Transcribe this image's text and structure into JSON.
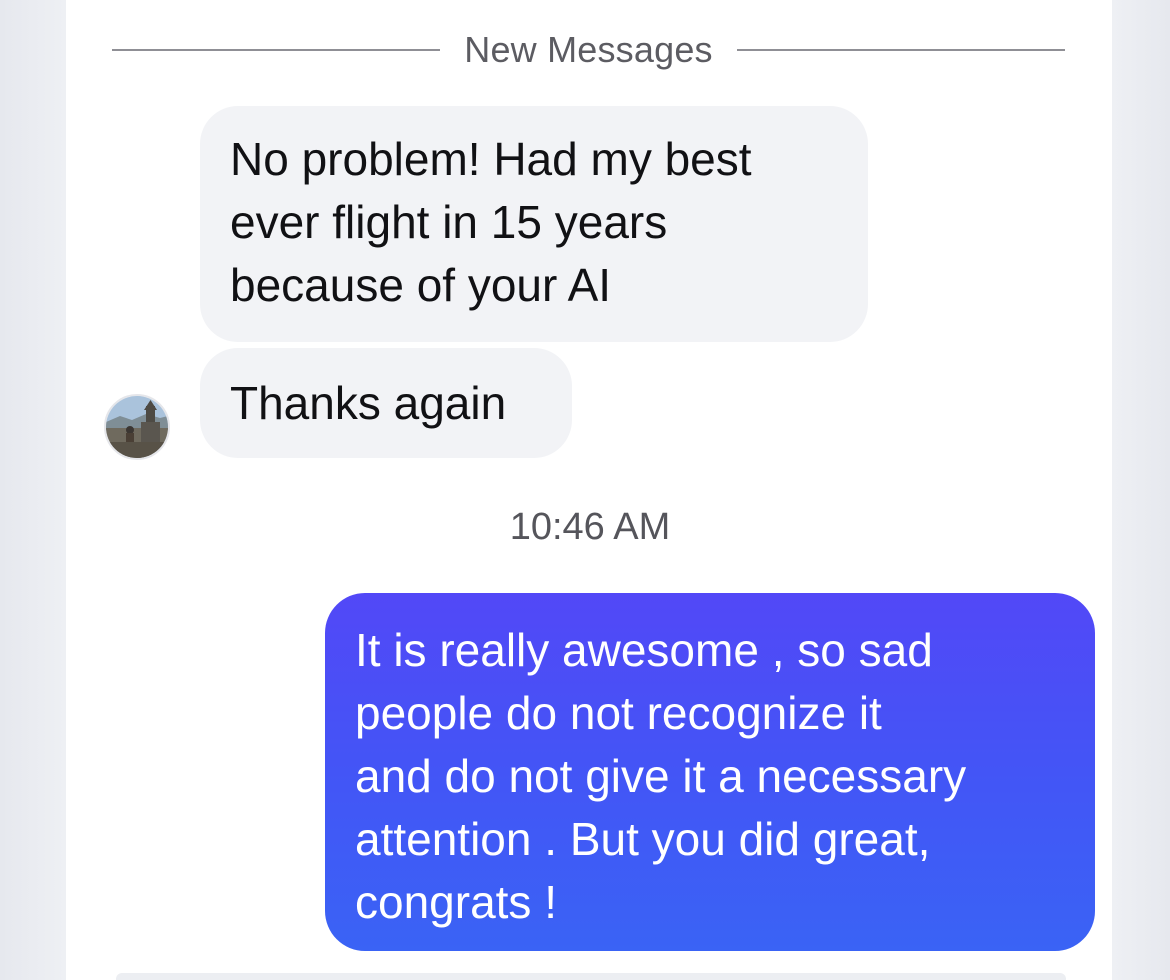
{
  "thread": {
    "new_messages_label": "New Messages",
    "timestamp": "10:46 AM",
    "incoming": [
      {
        "text": "No problem! Had my best\never flight in 15 years\nbecause of your AI"
      },
      {
        "text": "Thanks again"
      }
    ],
    "outgoing": [
      {
        "text": "It is really awesome , so sad\npeople do not recognize it\nand do not give it a necessary\nattention . But you did great,\ncongrats !"
      }
    ]
  },
  "colors": {
    "incoming_bubble": "#f2f3f6",
    "outgoing_bubble_top": "#5248f7",
    "outgoing_bubble_bottom": "#3a63f5",
    "outgoing_text": "#ffffff",
    "divider_line": "#8f8f95"
  },
  "icons": {
    "avatar": "contact-avatar-photo"
  }
}
